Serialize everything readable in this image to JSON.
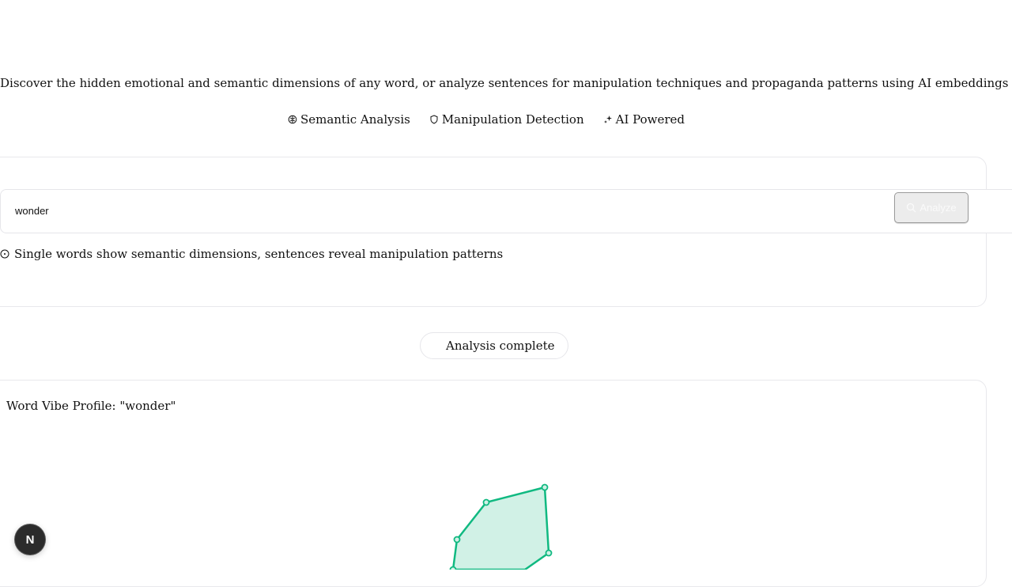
{
  "header": {
    "tagline": "Discover the hidden emotional and semantic dimensions of any word, or analyze sentences for manipulation techniques and propaganda patterns using AI embeddings",
    "features": [
      {
        "icon": "brain-icon",
        "label": "Semantic Analysis"
      },
      {
        "icon": "shield-icon",
        "label": "Manipulation Detection"
      },
      {
        "icon": "sparkles-icon",
        "label": "AI Powered"
      }
    ]
  },
  "search": {
    "value": "wonder",
    "placeholder": "",
    "button_label": "Analyze",
    "hint": "Single words show semantic dimensions, sentences reveal manipulation patterns"
  },
  "status": {
    "label": "Analysis complete"
  },
  "result": {
    "title": "Word Vibe Profile: \"wonder\""
  },
  "colors": {
    "accent": "#10b981",
    "accent_fill": "#d1f1e6",
    "border": "#e6e6ea"
  },
  "fab": {
    "label": "N"
  }
}
